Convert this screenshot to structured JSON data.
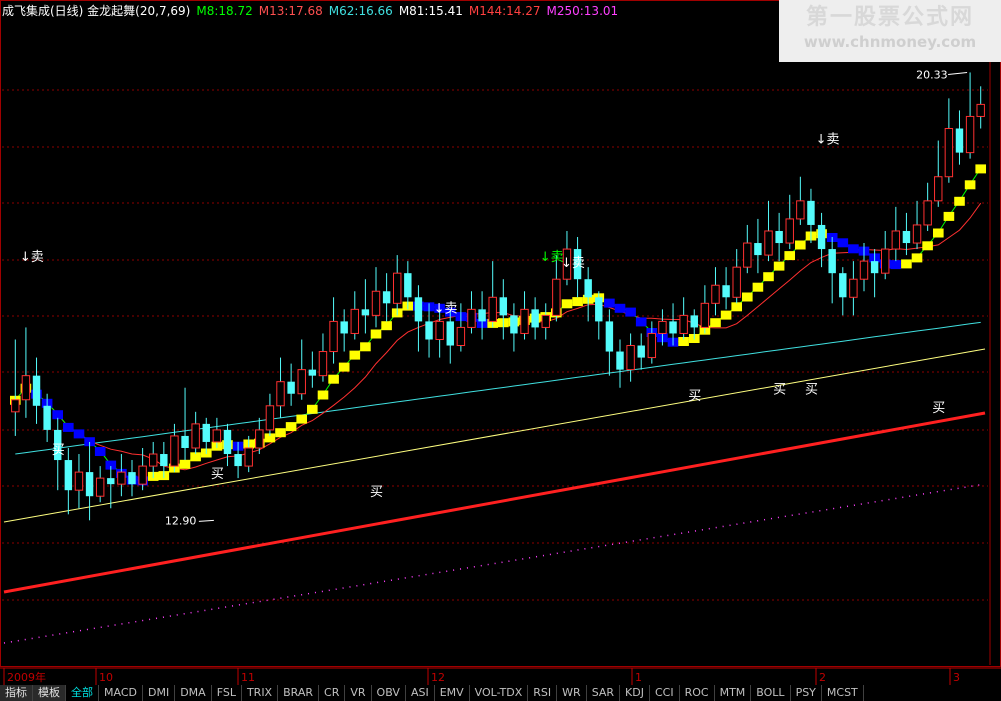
{
  "header": {
    "title": "成飞集成(日线) 金龙起舞(20,7,69)",
    "ma": [
      {
        "label": "M8:18.72",
        "color": "#00ff00"
      },
      {
        "label": "M13:17.68",
        "color": "#ff5050"
      },
      {
        "label": "M62:16.66",
        "color": "#40e0e0"
      },
      {
        "label": "M81:15.41",
        "color": "#ffffff"
      },
      {
        "label": "M144:14.27",
        "color": "#ff4040"
      },
      {
        "label": "M250:13.01",
        "color": "#ff40ff"
      }
    ]
  },
  "watermark": {
    "line1": "第一股票公式网",
    "line2": "www.chnmoney.com"
  },
  "tabs": [
    "指标",
    "模板",
    "全部",
    "MACD",
    "DMI",
    "DMA",
    "FSL",
    "TRIX",
    "BRAR",
    "CR",
    "VR",
    "OBV",
    "ASI",
    "EMV",
    "VOL-TDX",
    "RSI",
    "WR",
    "SAR",
    "KDJ",
    "CCI",
    "ROC",
    "MTM",
    "BOLL",
    "PSY",
    "MCST"
  ],
  "colors": {
    "up": "#54fcfc",
    "down": "#54fcfc",
    "yellow": "#ffff00",
    "blue": "#0000ff",
    "grid": "#8b0000",
    "axis": "#c00000"
  },
  "chart_data": {
    "type": "candlestick",
    "title": "成飞集成(日线) 金龙起舞(20,7,69)",
    "ylim": [
      10.5,
      21.2
    ],
    "x_ticks": [
      "2009年",
      "10",
      "11",
      "12",
      "1",
      "2",
      "3"
    ],
    "annotations": [
      {
        "text": "20.33",
        "kind": "high"
      },
      {
        "text": "12.90",
        "kind": "low"
      }
    ],
    "signals": [
      {
        "text": "卖",
        "index": 1,
        "price": 17.2,
        "type": "sell"
      },
      {
        "text": "买",
        "index": 4,
        "price": 14.0,
        "type": "buy"
      },
      {
        "text": "买",
        "index": 19,
        "price": 13.6,
        "type": "buy"
      },
      {
        "text": "卖",
        "index": 40,
        "price": 16.35,
        "type": "sell"
      },
      {
        "text": "买",
        "index": 34,
        "price": 13.3,
        "type": "buy"
      },
      {
        "text": "卖",
        "index": 50,
        "price": 17.2,
        "type": "sell",
        "alt": true
      },
      {
        "text": "卖",
        "index": 52,
        "price": 17.1,
        "type": "sell"
      },
      {
        "text": "买",
        "index": 64,
        "price": 14.9,
        "type": "buy"
      },
      {
        "text": "卖",
        "index": 76,
        "price": 19.15,
        "type": "sell"
      },
      {
        "text": "买",
        "index": 72,
        "price": 15.0,
        "type": "buy"
      },
      {
        "text": "买",
        "index": 75,
        "price": 15.0,
        "type": "buy"
      },
      {
        "text": "买",
        "index": 87,
        "price": 14.7,
        "type": "buy"
      },
      {
        "text": "卖",
        "index": 105,
        "price": 19.0,
        "type": "sell"
      },
      {
        "text": "买",
        "index": 118,
        "price": 15.5,
        "type": "buy"
      },
      {
        "text": "卖",
        "index": 124,
        "price": 19.15,
        "type": "sell"
      },
      {
        "text": "买",
        "index": 129,
        "price": 16.2,
        "type": "buy"
      },
      {
        "text": "买",
        "index": 133,
        "price": 16.2,
        "type": "buy"
      }
    ],
    "candles": [
      [
        14.7,
        14.9,
        14.3,
        15.9
      ],
      [
        14.9,
        15.3,
        14.6,
        16.1
      ],
      [
        15.3,
        14.8,
        14.5,
        15.6
      ],
      [
        14.8,
        14.4,
        14.2,
        15.0
      ],
      [
        14.4,
        13.9,
        13.4,
        14.6
      ],
      [
        13.9,
        13.4,
        13.0,
        14.1
      ],
      [
        13.4,
        13.7,
        13.1,
        14.0
      ],
      [
        13.7,
        13.3,
        12.9,
        14.2
      ],
      [
        13.3,
        13.6,
        13.2,
        13.8
      ],
      [
        13.6,
        13.5,
        13.1,
        13.8
      ],
      [
        13.5,
        13.7,
        13.3,
        14.0
      ],
      [
        13.7,
        13.5,
        13.3,
        13.9
      ],
      [
        13.5,
        13.8,
        13.4,
        14.1
      ],
      [
        13.8,
        14.0,
        13.6,
        14.2
      ],
      [
        14.0,
        13.8,
        13.6,
        14.2
      ],
      [
        13.8,
        14.3,
        13.7,
        14.5
      ],
      [
        14.3,
        14.1,
        13.9,
        15.1
      ],
      [
        14.1,
        14.5,
        14.0,
        14.7
      ],
      [
        14.5,
        14.2,
        14.0,
        14.6
      ],
      [
        14.2,
        14.4,
        14.1,
        14.6
      ],
      [
        14.4,
        14.0,
        13.8,
        14.5
      ],
      [
        14.0,
        13.8,
        13.6,
        14.2
      ],
      [
        13.8,
        14.1,
        13.7,
        14.3
      ],
      [
        14.1,
        14.4,
        14.0,
        14.6
      ],
      [
        14.4,
        14.8,
        14.3,
        15.0
      ],
      [
        14.8,
        15.2,
        14.6,
        15.6
      ],
      [
        15.2,
        15.0,
        14.8,
        15.5
      ],
      [
        15.0,
        15.4,
        14.9,
        15.9
      ],
      [
        15.4,
        15.3,
        15.1,
        15.7
      ],
      [
        15.3,
        15.7,
        15.2,
        16.0
      ],
      [
        15.7,
        16.2,
        15.5,
        16.6
      ],
      [
        16.2,
        16.0,
        15.7,
        16.4
      ],
      [
        16.0,
        16.4,
        15.9,
        16.7
      ],
      [
        16.4,
        16.3,
        16.0,
        16.9
      ],
      [
        16.3,
        16.7,
        16.1,
        17.1
      ],
      [
        16.7,
        16.5,
        16.2,
        17.0
      ],
      [
        16.5,
        17.0,
        16.3,
        17.3
      ],
      [
        17.0,
        16.6,
        16.4,
        17.2
      ],
      [
        16.6,
        16.2,
        15.7,
        16.8
      ],
      [
        16.2,
        15.9,
        15.6,
        16.5
      ],
      [
        15.9,
        16.2,
        15.6,
        16.4
      ],
      [
        16.2,
        15.8,
        15.5,
        16.4
      ],
      [
        15.8,
        16.1,
        15.7,
        16.5
      ],
      [
        16.1,
        16.4,
        16.0,
        16.7
      ],
      [
        16.4,
        16.2,
        15.9,
        16.7
      ],
      [
        16.2,
        16.6,
        16.1,
        17.2
      ],
      [
        16.6,
        16.3,
        15.9,
        16.9
      ],
      [
        16.3,
        16.0,
        15.7,
        16.5
      ],
      [
        16.0,
        16.4,
        15.9,
        16.7
      ],
      [
        16.4,
        16.1,
        15.9,
        16.6
      ],
      [
        16.1,
        16.3,
        15.9,
        16.5
      ],
      [
        16.3,
        16.9,
        16.2,
        17.3
      ],
      [
        16.9,
        17.4,
        16.8,
        17.7
      ],
      [
        17.4,
        16.9,
        16.6,
        17.6
      ],
      [
        16.9,
        16.6,
        16.2,
        17.1
      ],
      [
        16.6,
        16.2,
        15.9,
        16.7
      ],
      [
        16.2,
        15.7,
        15.3,
        16.4
      ],
      [
        15.7,
        15.4,
        15.1,
        15.9
      ],
      [
        15.4,
        15.8,
        15.2,
        16.0
      ],
      [
        15.8,
        15.6,
        15.4,
        16.0
      ],
      [
        15.6,
        16.0,
        15.5,
        16.2
      ],
      [
        16.0,
        16.2,
        15.8,
        16.4
      ],
      [
        16.2,
        16.0,
        15.8,
        16.5
      ],
      [
        16.0,
        16.3,
        15.9,
        16.6
      ],
      [
        16.3,
        16.1,
        15.9,
        16.4
      ],
      [
        16.1,
        16.5,
        16.0,
        16.8
      ],
      [
        16.5,
        16.8,
        16.3,
        17.1
      ],
      [
        16.8,
        16.6,
        16.4,
        17.1
      ],
      [
        16.6,
        17.1,
        16.5,
        17.4
      ],
      [
        17.1,
        17.5,
        17.0,
        17.8
      ],
      [
        17.5,
        17.3,
        17.0,
        17.9
      ],
      [
        17.3,
        17.7,
        17.2,
        18.2
      ],
      [
        17.7,
        17.5,
        17.2,
        18.0
      ],
      [
        17.5,
        17.9,
        17.4,
        18.3
      ],
      [
        17.9,
        18.2,
        17.8,
        18.6
      ],
      [
        18.2,
        17.8,
        17.5,
        18.4
      ],
      [
        17.8,
        17.4,
        17.1,
        18.0
      ],
      [
        17.4,
        17.0,
        16.5,
        17.6
      ],
      [
        17.0,
        16.6,
        16.3,
        17.1
      ],
      [
        16.6,
        16.9,
        16.3,
        17.2
      ],
      [
        16.9,
        17.2,
        16.7,
        17.5
      ],
      [
        17.2,
        17.0,
        16.6,
        17.4
      ],
      [
        17.0,
        17.4,
        16.9,
        17.7
      ],
      [
        17.4,
        17.7,
        17.2,
        18.1
      ],
      [
        17.7,
        17.5,
        17.3,
        18.0
      ],
      [
        17.5,
        17.8,
        17.4,
        18.2
      ],
      [
        17.8,
        18.2,
        17.7,
        18.5
      ],
      [
        18.2,
        18.6,
        18.1,
        19.2
      ],
      [
        18.6,
        19.4,
        18.5,
        19.9
      ],
      [
        19.4,
        19.0,
        18.8,
        19.7
      ],
      [
        19.0,
        19.6,
        18.9,
        20.33
      ],
      [
        19.6,
        19.8,
        19.4,
        20.1
      ]
    ]
  }
}
